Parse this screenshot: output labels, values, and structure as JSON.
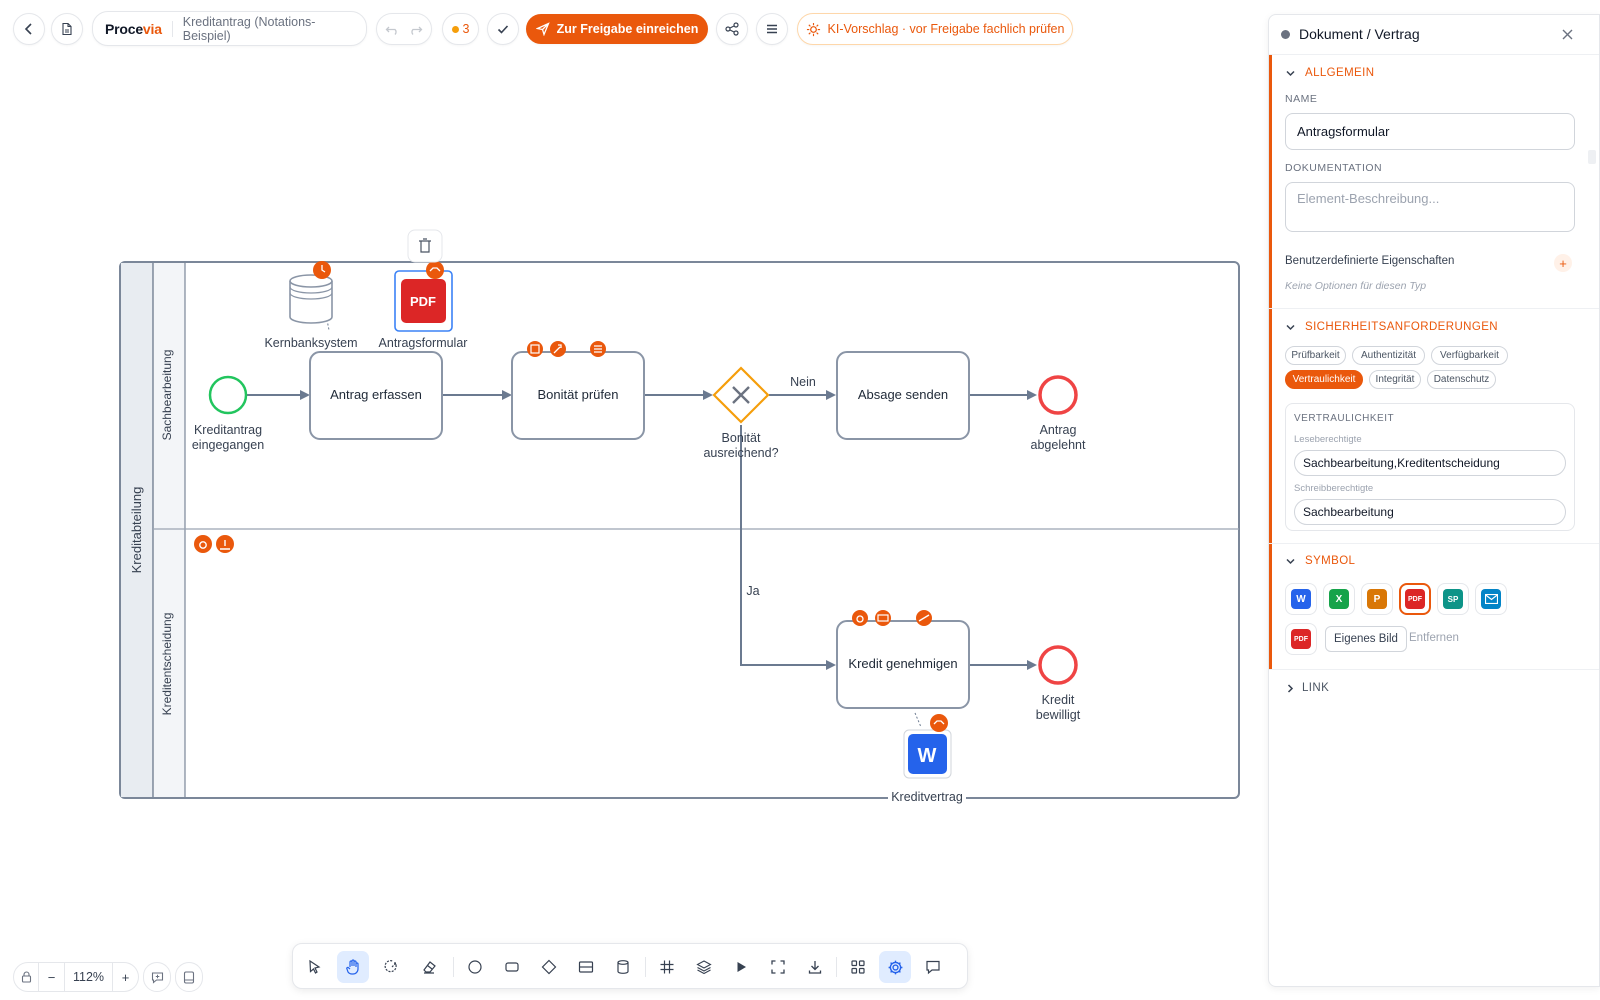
{
  "topbar": {
    "brand_prefix": "Proce",
    "brand_suffix": "via",
    "document_title": "Kreditantrag (Notations-Beispiel)",
    "issue_count": "3",
    "submit_label": "Zur Freigabe einreichen",
    "ai_hint": "KI-Vorschlag · vor Freigabe fachlich prüfen"
  },
  "diagram": {
    "pool_label": "Kreditabteilung",
    "lanes": [
      "Sachbearbeitung",
      "Kreditentscheidung"
    ],
    "start_event": [
      "Kreditantrag",
      "eingegangen"
    ],
    "tasks": {
      "antrag": "Antrag erfassen",
      "bonitaet": "Bonität prüfen",
      "absage": "Absage senden",
      "kredit": "Kredit genehmigen"
    },
    "gateway": [
      "Bonität",
      "ausreichend?"
    ],
    "flow_labels": {
      "no": "Nein",
      "yes": "Ja"
    },
    "end_events": {
      "rejected": [
        "Antrag",
        "abgelehnt"
      ],
      "approved": [
        "Kredit",
        "bewilligt"
      ]
    },
    "data_store": "Kernbanksystem",
    "documents": {
      "form": "Antragsformular",
      "contract": "Kreditvertrag"
    },
    "pdf_glyph": "PDF",
    "word_glyph": "W"
  },
  "panel": {
    "header_title": "Dokument / Vertrag",
    "general": {
      "title": "Allgemein",
      "name_label": "Name",
      "name_value": "Antragsformular",
      "doc_label": "Dokumentation",
      "doc_placeholder": "Element-Beschreibung...",
      "custom_props": "Benutzerdefinierte Eigenschaften",
      "custom_empty": "Keine Optionen für diesen Typ"
    },
    "security": {
      "title": "Sicherheitsanforderungen",
      "chips": [
        "Prüfbarkeit",
        "Authentizität",
        "Verfügbarkeit",
        "Vertraulichkeit",
        "Integrität",
        "Datenschutz"
      ],
      "active_chip": "Vertraulichkeit",
      "box_title": "Vertraulichkeit",
      "read_label": "Leseberechtigte",
      "read_value": "Sachbearbeitung,Kreditentscheidung",
      "write_label": "Schreibberechtigte",
      "write_value": "Sachbearbeitung"
    },
    "symbol": {
      "title": "Symbol",
      "options": [
        {
          "label": "W",
          "color": "#2563eb"
        },
        {
          "label": "X",
          "color": "#16a34a"
        },
        {
          "label": "P",
          "color": "#d97706"
        },
        {
          "label": "PDF",
          "color": "#dc2626"
        },
        {
          "label": "SP",
          "color": "#0d9488"
        },
        {
          "label": "",
          "color": "#0284c7"
        }
      ],
      "current": "PDF",
      "own_image": "Eigenes Bild",
      "remove": "Entfernen"
    },
    "link": {
      "title": "Link"
    }
  },
  "zoom": {
    "level": "112%"
  },
  "colors": {
    "accent": "#ea580c",
    "start": "#22c55e",
    "end": "#ef4444",
    "gateway": "#f59e0b",
    "edge": "#6b7a90"
  }
}
